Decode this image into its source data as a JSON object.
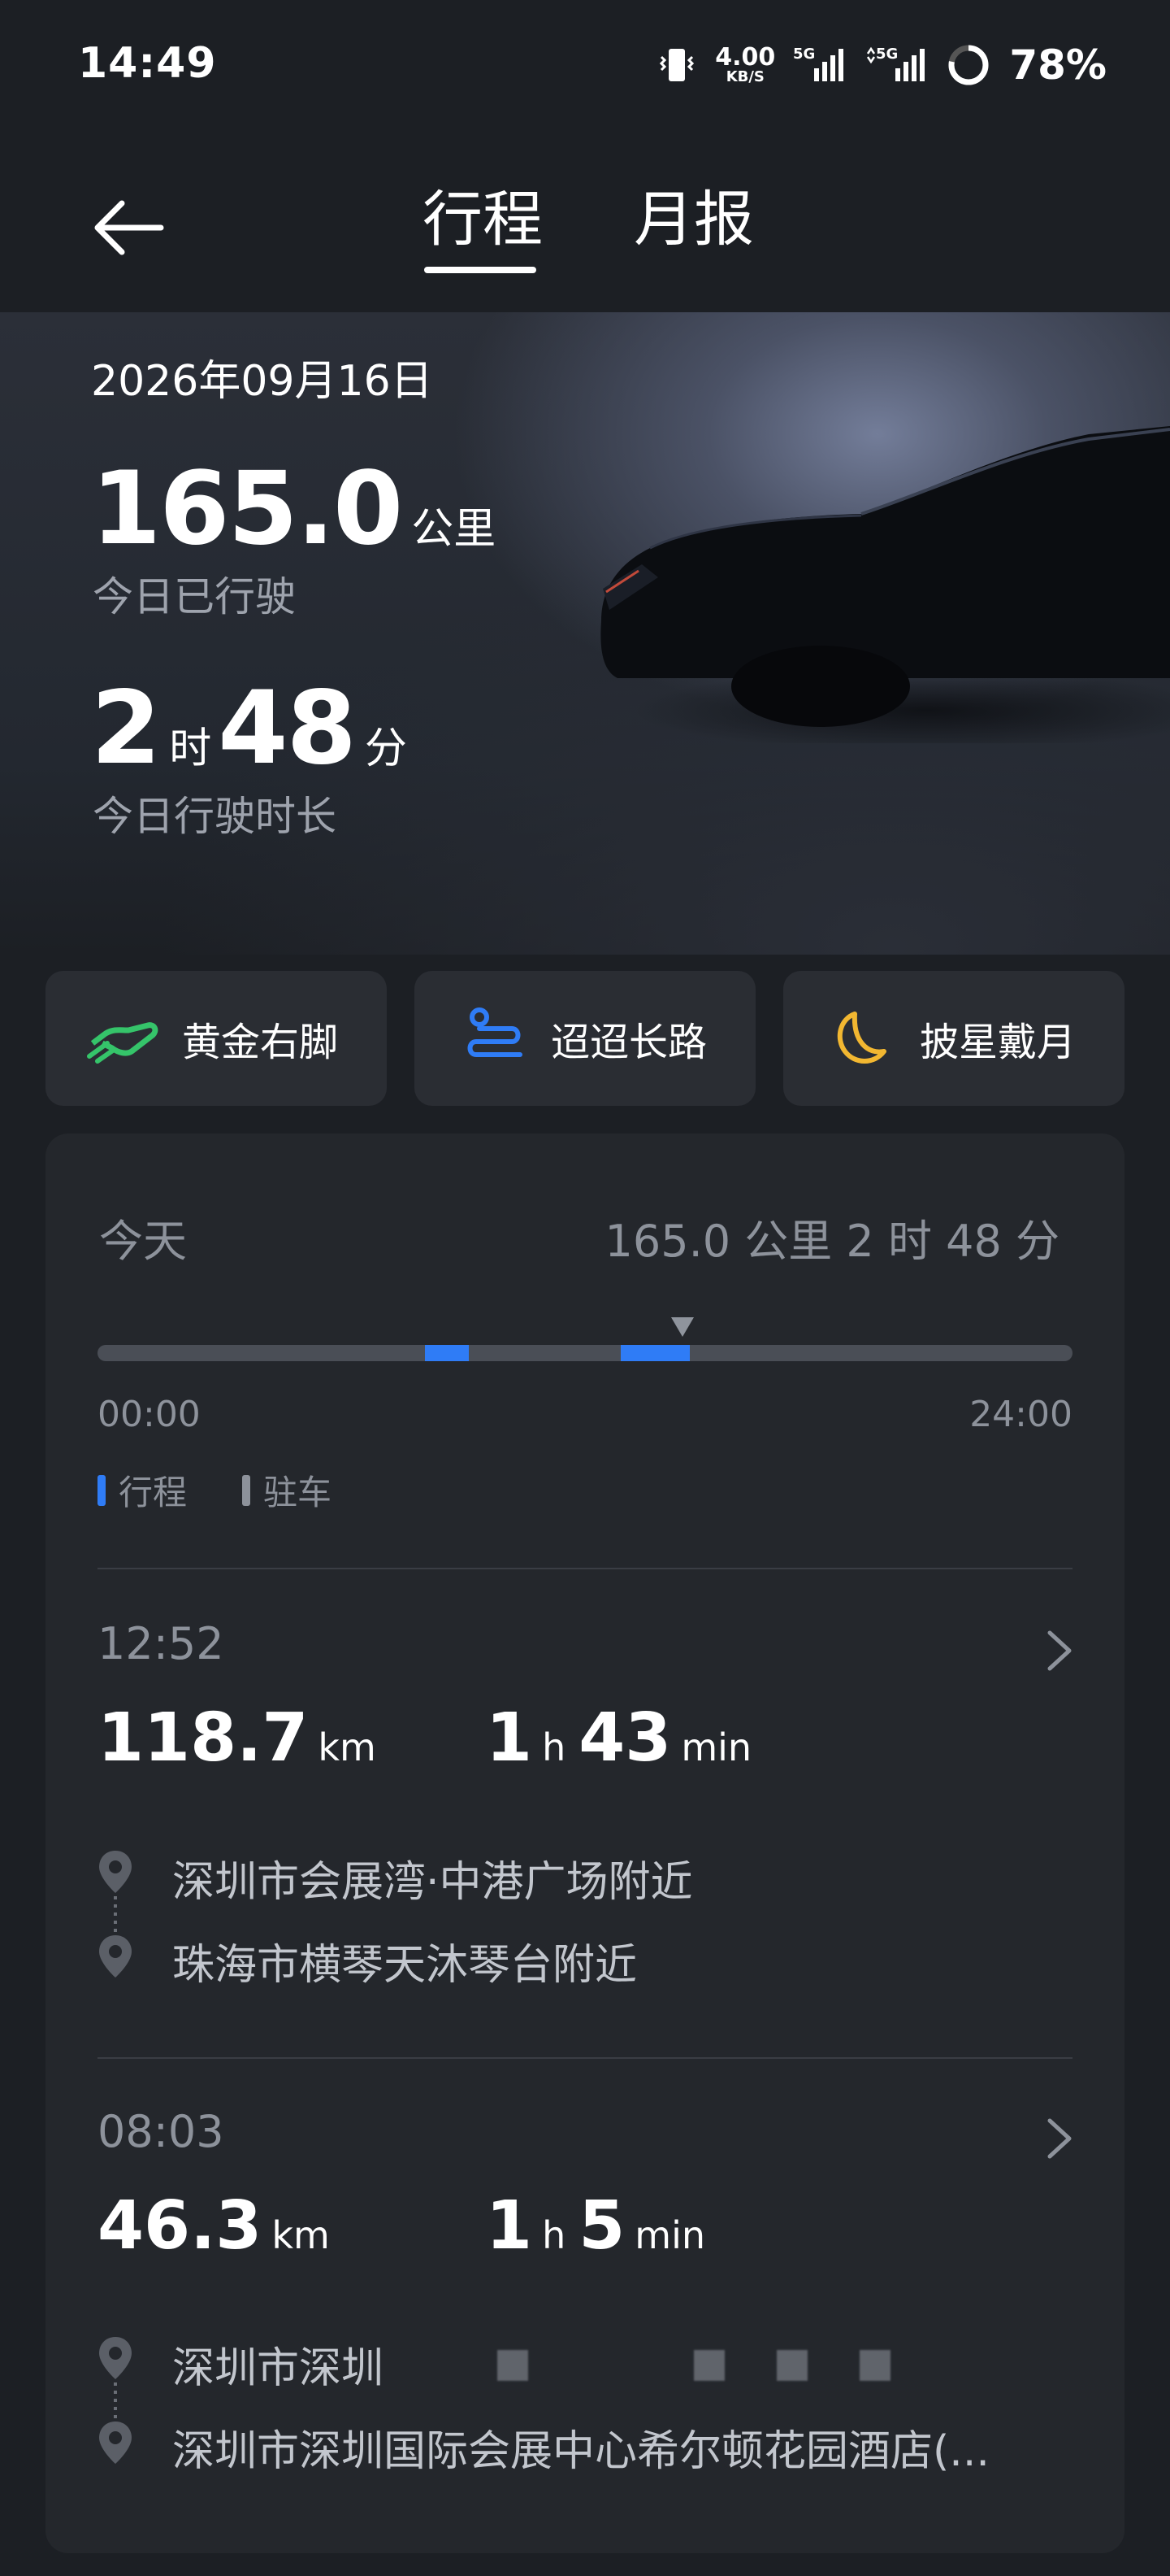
{
  "status_bar": {
    "time": "14:49",
    "speed_value": "4.00",
    "speed_unit": "KB/S",
    "net1": "5G",
    "net2": "5G",
    "battery": "78%"
  },
  "header": {
    "tabs": [
      {
        "label": "行程",
        "active": true
      },
      {
        "label": "月报",
        "active": false
      }
    ]
  },
  "hero": {
    "date": "2026年09月16日",
    "distance_value": "165.0",
    "distance_unit": "公里",
    "distance_caption": "今日已行驶",
    "duration_hours": "2",
    "duration_hours_unit": "时",
    "duration_minutes": "48",
    "duration_minutes_unit": "分",
    "duration_caption": "今日行驶时长"
  },
  "badges": [
    {
      "label": "黄金右脚",
      "icon": "golden-foot-icon",
      "color": "#35c46a"
    },
    {
      "label": "迢迢长路",
      "icon": "long-road-icon",
      "color": "#2f7cf6"
    },
    {
      "label": "披星戴月",
      "icon": "moon-icon",
      "color": "#f2b731"
    }
  ],
  "summary": {
    "day_label": "今天",
    "total": "165.0 公里  2 时 48 分",
    "timeline_start": "00:00",
    "timeline_end": "24:00",
    "legend": [
      {
        "label": "行程",
        "color": "#2f7cf6"
      },
      {
        "label": "驻车",
        "color": "#8d929b"
      }
    ],
    "trips_on_timeline": [
      {
        "start_hour": 8.05,
        "end_hour": 9.13
      },
      {
        "start_hour": 12.87,
        "end_hour": 14.58
      }
    ],
    "marker_hour": 14.4
  },
  "trips": [
    {
      "time": "12:52",
      "distance": "118.7",
      "distance_unit": "km",
      "hours": "1",
      "hours_unit": "h",
      "minutes": "43",
      "minutes_unit": "min",
      "from": "深圳市会展湾·中港广场附近",
      "to": "珠海市横琴天沐琴台附近"
    },
    {
      "time": "08:03",
      "distance": "46.3",
      "distance_unit": "km",
      "hours": "1",
      "hours_unit": "h",
      "minutes": "5",
      "minutes_unit": "min",
      "from": "深圳市深圳",
      "to": "深圳市深圳国际会展中心希尔顿花园酒店(..."
    }
  ],
  "colors": {
    "accent": "#2f7cf6",
    "background": "#1c1f24",
    "card": "#24272c"
  }
}
